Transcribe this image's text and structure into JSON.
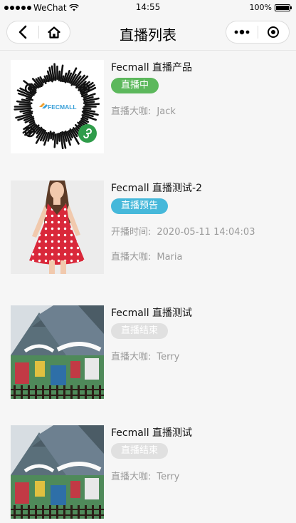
{
  "status_bar": {
    "carrier": "WeChat",
    "time": "14:55",
    "battery": "100%",
    "battery_level": 1.0
  },
  "nav": {
    "title": "直播列表",
    "back_icon": "chevron-left-icon",
    "home_icon": "home-icon",
    "more_icon": "more-dots-icon",
    "target_icon": "target-circle-icon"
  },
  "items": [
    {
      "title": "Fecmall 直播产品",
      "badge": "直播中",
      "badge_type": "live",
      "host_label": "直播大咖:",
      "host": "Jack"
    },
    {
      "title": "Fecmall 直播测试-2",
      "badge": "直播预告",
      "badge_type": "preview",
      "start_label": "开播时间:",
      "start_time": "2020-05-11 14:04:03",
      "host_label": "直播大咖:",
      "host": "Maria"
    },
    {
      "title": "Fecmall 直播测试",
      "badge": "直播结束",
      "badge_type": "ended",
      "host_label": "直播大咖:",
      "host": "Terry"
    },
    {
      "title": "Fecmall 直播测试",
      "badge": "直播结束",
      "badge_type": "ended",
      "host_label": "直播大咖:",
      "host": "Terry"
    }
  ],
  "qr_logo_text": "FECMALL",
  "colors": {
    "live": "#5cb85c",
    "preview": "#46b8da",
    "ended": "#e0e0e0"
  }
}
